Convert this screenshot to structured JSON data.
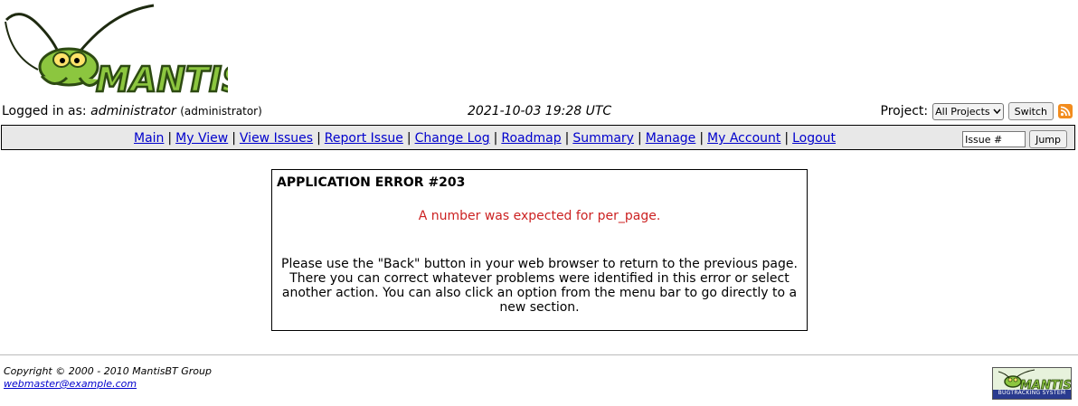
{
  "logo": {
    "text": "MANTIS"
  },
  "login": {
    "prefix": "Logged in as:",
    "username": "administrator",
    "role": "(administrator)",
    "datetime": "2021-10-03 19:28 UTC",
    "project_label": "Project:",
    "project_selected": "All Projects",
    "switch_label": "Switch"
  },
  "menu": {
    "items": [
      "Main",
      "My View",
      "View Issues",
      "Report Issue",
      "Change Log",
      "Roadmap",
      "Summary",
      "Manage",
      "My Account",
      "Logout"
    ],
    "separator": "|",
    "issue_placeholder": "Issue #",
    "jump_label": "Jump"
  },
  "error": {
    "title": "APPLICATION ERROR #203",
    "message": "A number was expected for per_page.",
    "help": "Please use the \"Back\" button in your web browser to return to the previous page. There you can correct whatever problems were identified in this error or select another action. You can also click an option from the menu bar to go directly to a new section."
  },
  "footer": {
    "copyright": "Copyright © 2000 - 2010 MantisBT Group",
    "email": "webmaster@example.com",
    "powered_logo_text": "MANTIS",
    "powered_tagline": "BUGTRACKING SYSTEM"
  },
  "colors": {
    "link": "#0000cc",
    "error": "#cc2222",
    "menu_bg": "#e8e8e8",
    "logo_green": "#8cc63f"
  },
  "icons": {
    "rss": "rss-feed-icon",
    "dropdown": "chevron-down-icon"
  }
}
